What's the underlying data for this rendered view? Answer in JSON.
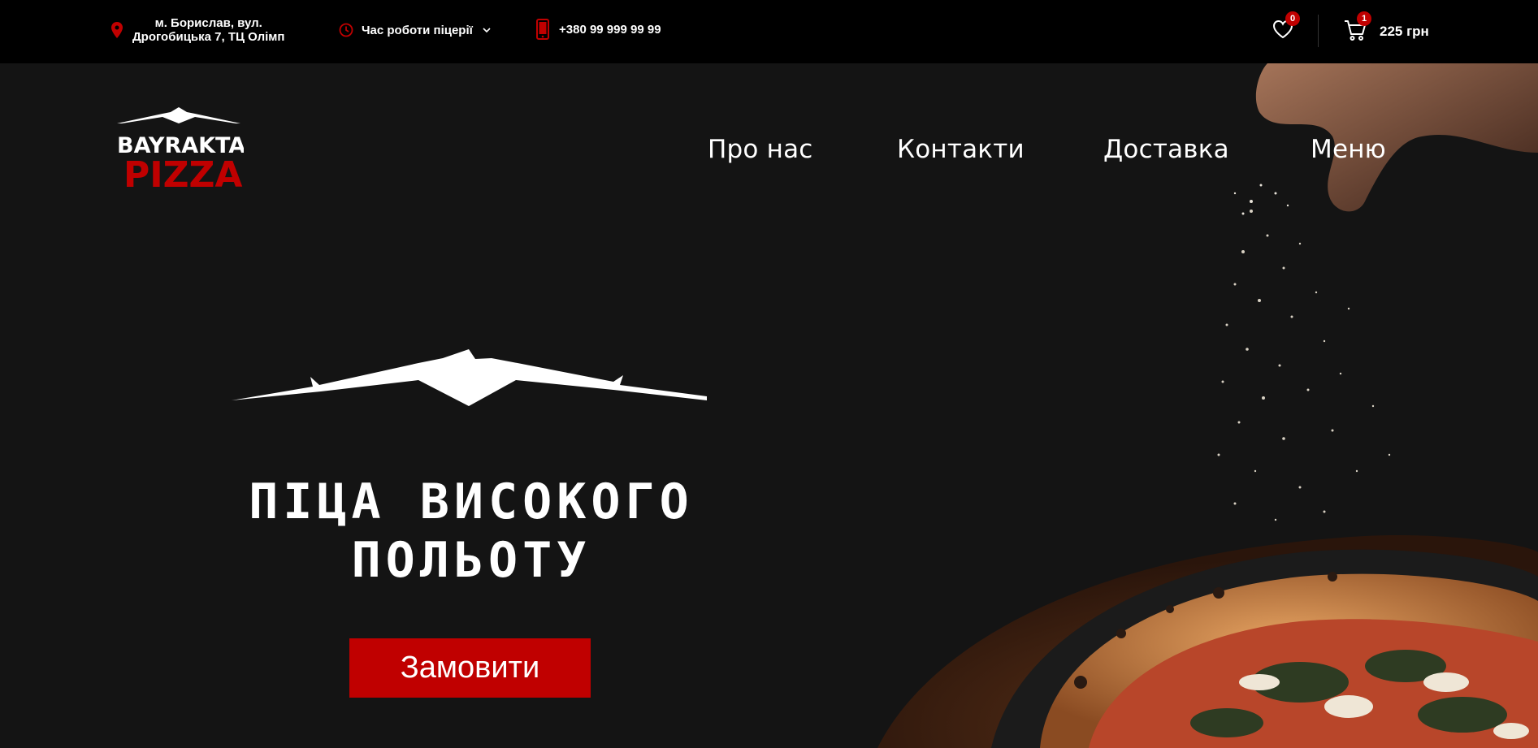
{
  "topbar": {
    "address_line1": "м. Борислав, вул.",
    "address_line2": "Дрогобицька 7, ТЦ Олімп",
    "hours_label": "Час роботи піцерії",
    "phone": "+380 99 999 99 99",
    "wishlist_count": "0",
    "cart_count": "1",
    "cart_total": "225 грн"
  },
  "logo": {
    "top": "BAYRAKTAR",
    "bottom": "PIZZA"
  },
  "nav": {
    "items": [
      "Про нас",
      "Контакти",
      "Доставка",
      "Меню"
    ]
  },
  "hero": {
    "headline_line1": "ПІЦА ВИСОКОГО",
    "headline_line2": "ПОЛЬОТУ",
    "cta_label": "Замовити"
  },
  "colors": {
    "accent": "#c00000",
    "topbar_bg": "#000000",
    "hero_bg": "#141414"
  },
  "icons": [
    "location-pin-icon",
    "clock-icon",
    "phone-icon",
    "chevron-down-icon",
    "heart-icon",
    "cart-icon",
    "drone-icon"
  ]
}
